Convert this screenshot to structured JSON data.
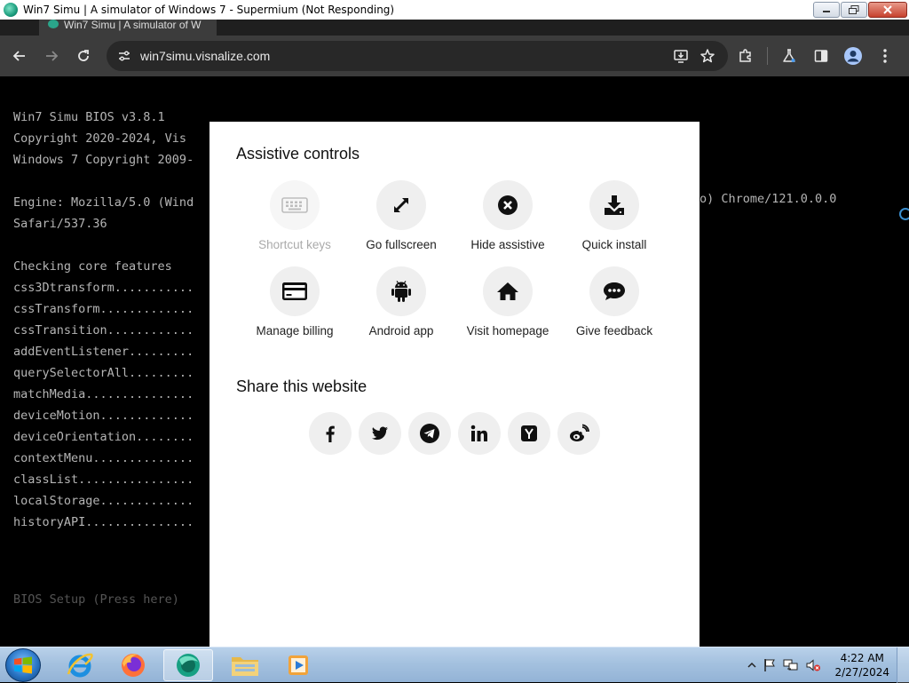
{
  "window": {
    "title": "Win7 Simu | A simulator of Windows 7 - Supermium (Not Responding)"
  },
  "browser": {
    "tab_title": "Win7 Simu | A simulator of W",
    "url": "win7simu.visnalize.com"
  },
  "bios": {
    "lines": [
      "Win7 Simu BIOS v3.8.1",
      "Copyright 2020-2024, Vis",
      "Windows 7 Copyright 2009-",
      "",
      "Engine: Mozilla/5.0 (Wind",
      "Safari/537.36",
      "",
      "Checking core features",
      "css3Dtransform...........",
      "cssTransform.............",
      "cssTransition............",
      "addEventListener.........",
      "querySelectorAll.........",
      "matchMedia...............",
      "deviceMotion.............",
      "deviceOrientation........",
      "contextMenu..............",
      "classList................",
      "localStorage.............",
      "historyAPI..............."
    ],
    "engine_tail": "o) Chrome/121.0.0.0",
    "setup_hint": "BIOS Setup (Press here)"
  },
  "modal": {
    "assistive_title": "Assistive controls",
    "share_title": "Share this website",
    "controls": [
      {
        "label": "Shortcut keys",
        "icon": "keyboard-icon",
        "disabled": true
      },
      {
        "label": "Go fullscreen",
        "icon": "fullscreen-icon",
        "disabled": false
      },
      {
        "label": "Hide assistive",
        "icon": "close-circle-icon",
        "disabled": false
      },
      {
        "label": "Quick install",
        "icon": "download-icon",
        "disabled": false
      },
      {
        "label": "Manage billing",
        "icon": "credit-card-icon",
        "disabled": false
      },
      {
        "label": "Android app",
        "icon": "android-icon",
        "disabled": false
      },
      {
        "label": "Visit homepage",
        "icon": "home-icon",
        "disabled": false
      },
      {
        "label": "Give feedback",
        "icon": "chat-bubble-icon",
        "disabled": false
      }
    ],
    "share": [
      {
        "icon": "facebook-icon"
      },
      {
        "icon": "twitter-icon"
      },
      {
        "icon": "telegram-icon"
      },
      {
        "icon": "linkedin-icon"
      },
      {
        "icon": "ycombinator-icon"
      },
      {
        "icon": "weibo-icon"
      }
    ]
  },
  "taskbar": {
    "time": "4:22 AM",
    "date": "2/27/2024"
  }
}
